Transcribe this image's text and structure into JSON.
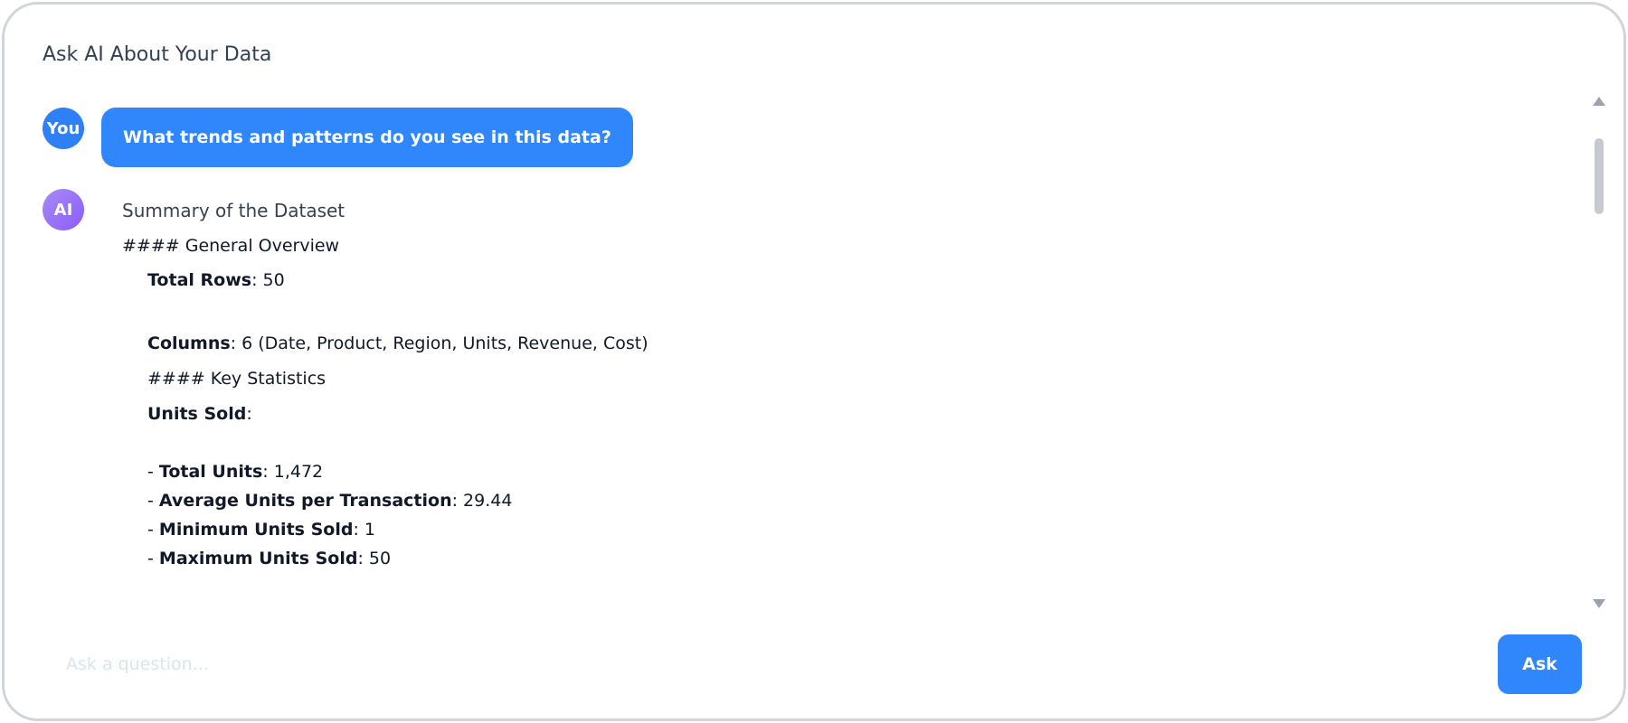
{
  "panel": {
    "title": "Ask AI About Your Data"
  },
  "chat": {
    "user": {
      "avatar_label": "You",
      "message": "What trends and patterns do you see in this data?"
    },
    "ai": {
      "avatar_label": "AI",
      "heading": "Summary of the Dataset",
      "general_overview": "#### General Overview",
      "total_rows": {
        "label": "Total Rows",
        "value": ": 50"
      },
      "columns": {
        "label": "Columns",
        "value": ": 6 (Date, Product, Region, Units, Revenue, Cost)"
      },
      "key_statistics": "#### Key Statistics",
      "units_sold": {
        "label": "Units Sold",
        "value": ":"
      },
      "stats": [
        {
          "prefix": "- ",
          "label": "Total Units",
          "value": ": 1,472"
        },
        {
          "prefix": "- ",
          "label": "Average Units per Transaction",
          "value": ": 29.44"
        },
        {
          "prefix": "- ",
          "label": "Minimum Units Sold",
          "value": ": 1"
        },
        {
          "prefix": "- ",
          "label": "Maximum Units Sold",
          "value": ": 50"
        }
      ]
    }
  },
  "input": {
    "placeholder": "Ask a question..."
  },
  "actions": {
    "ask_label": "Ask"
  }
}
